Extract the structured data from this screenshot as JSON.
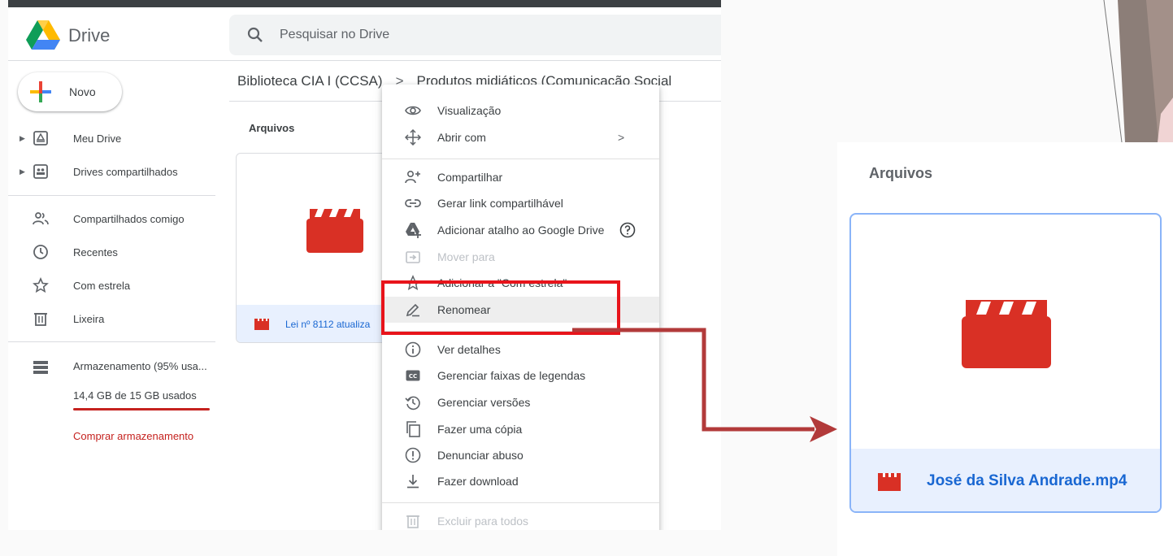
{
  "app": {
    "name": "Drive"
  },
  "search": {
    "placeholder": "Pesquisar no Drive"
  },
  "new_button": {
    "label": "Novo"
  },
  "sidebar": {
    "items": [
      {
        "label": "Meu Drive",
        "icon": "my-drive-icon"
      },
      {
        "label": "Drives compartilhados",
        "icon": "shared-drives-icon"
      },
      {
        "label": "Compartilhados comigo",
        "icon": "shared-with-me-icon"
      },
      {
        "label": "Recentes",
        "icon": "clock-icon"
      },
      {
        "label": "Com estrela",
        "icon": "star-icon"
      },
      {
        "label": "Lixeira",
        "icon": "trash-icon"
      }
    ],
    "storage": {
      "title": "Armazenamento (95% usa...",
      "used": "14,4 GB de 15 GB usados",
      "percent": 95,
      "buy_label": "Comprar armazenamento"
    }
  },
  "breadcrumb": {
    "parent": "Biblioteca CIA I (CCSA)",
    "separator": ">",
    "current": "Produtos midiáticos (Comunicação Social"
  },
  "files": {
    "section_label": "Arquivos",
    "card_name": "Lei nº 8112 atualiza"
  },
  "context_menu": {
    "items": [
      {
        "label": "Visualização",
        "icon": "eye-icon"
      },
      {
        "label": "Abrir com",
        "icon": "move-icon",
        "submenu_indicator": ">"
      },
      {
        "label": "Compartilhar",
        "icon": "add-person-icon"
      },
      {
        "label": "Gerar link compartilhável",
        "icon": "link-icon"
      },
      {
        "label": "Adicionar atalho ao Google Drive",
        "icon": "drive-shortcut-icon",
        "help_icon": "help-icon"
      },
      {
        "label": "Mover para",
        "icon": "move-to-icon",
        "disabled": true
      },
      {
        "label": "Adicionar a \"Com estrela\"",
        "icon": "star-icon"
      },
      {
        "label": "Renomear",
        "icon": "pencil-icon",
        "highlighted": true
      },
      {
        "label": "Ver detalhes",
        "icon": "info-icon"
      },
      {
        "label": "Gerenciar faixas de legendas",
        "icon": "cc-icon"
      },
      {
        "label": "Gerenciar versões",
        "icon": "history-icon"
      },
      {
        "label": "Fazer uma cópia",
        "icon": "copy-icon"
      },
      {
        "label": "Denunciar abuso",
        "icon": "alert-icon"
      },
      {
        "label": "Fazer download",
        "icon": "download-icon"
      },
      {
        "label": "Excluir para todos",
        "icon": "trash-icon",
        "disabled": true
      }
    ]
  },
  "zoom_panel": {
    "section_label": "Arquivos",
    "file_name": "José da Silva Andrade.mp4"
  },
  "colors": {
    "highlight_box": "#e8141b",
    "connector_arrow": "#b23a3a",
    "storage_red": "#c5221f",
    "link_blue": "#1967d2",
    "selected_bg": "#e8f0fe",
    "video_red": "#d93025"
  }
}
